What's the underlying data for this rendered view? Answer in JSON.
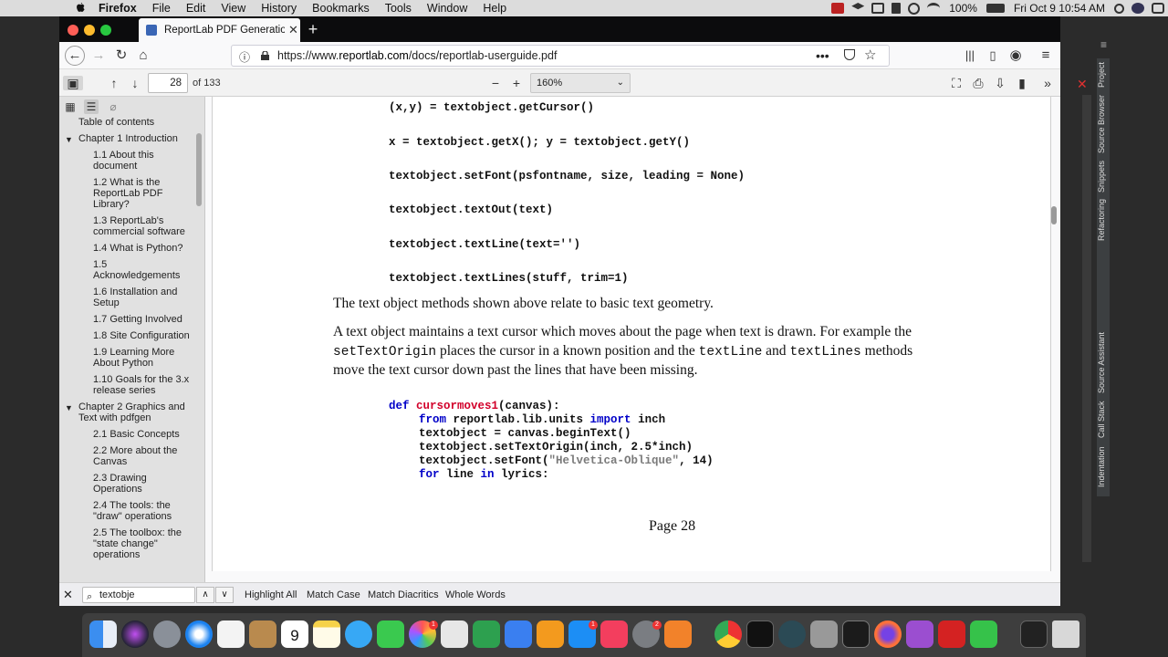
{
  "menubar": {
    "app_name": "Firefox",
    "items": [
      "File",
      "Edit",
      "View",
      "History",
      "Bookmarks",
      "Tools",
      "Window",
      "Help"
    ],
    "battery": "100%",
    "clock": "Fri Oct 9  10:54 AM"
  },
  "browser": {
    "tab_title": "ReportLab PDF Generation User Guide",
    "url_prefix": "https://www.",
    "url_domain": "reportlab.com",
    "url_path": "/docs/reportlab-userguide.pdf"
  },
  "pdf_toolbar": {
    "page_number": "28",
    "page_count": "of 133",
    "zoom": "160%"
  },
  "outline": [
    {
      "label": "Table of contents",
      "level": 0,
      "twisty": ""
    },
    {
      "label": "Chapter 1 Introduction",
      "level": 0,
      "twisty": "▼"
    },
    {
      "label": "1.1 About this document",
      "level": 1,
      "twisty": ""
    },
    {
      "label": "1.2 What is the ReportLab PDF Library?",
      "level": 1,
      "twisty": ""
    },
    {
      "label": "1.3 ReportLab's commercial software",
      "level": 1,
      "twisty": ""
    },
    {
      "label": "1.4 What is Python?",
      "level": 1,
      "twisty": ""
    },
    {
      "label": "1.5 Acknowledgements",
      "level": 1,
      "twisty": ""
    },
    {
      "label": "1.6 Installation and Setup",
      "level": 1,
      "twisty": ""
    },
    {
      "label": "1.7 Getting Involved",
      "level": 1,
      "twisty": ""
    },
    {
      "label": "1.8 Site Configuration",
      "level": 1,
      "twisty": ""
    },
    {
      "label": "1.9 Learning More About Python",
      "level": 1,
      "twisty": ""
    },
    {
      "label": "1.10 Goals for the 3.x release series",
      "level": 1,
      "twisty": ""
    },
    {
      "label": "Chapter 2 Graphics and Text with pdfgen",
      "level": 0,
      "twisty": "▼"
    },
    {
      "label": "2.1 Basic Concepts",
      "level": 1,
      "twisty": ""
    },
    {
      "label": "2.2 More about the Canvas",
      "level": 1,
      "twisty": ""
    },
    {
      "label": "2.3 Drawing Operations",
      "level": 1,
      "twisty": ""
    },
    {
      "label": "2.4 The tools: the \"draw\" operations",
      "level": 1,
      "twisty": ""
    },
    {
      "label": "2.5 The toolbox: the \"state change\" operations",
      "level": 1,
      "twisty": ""
    }
  ],
  "document": {
    "code_lines": [
      "(x,y) = textobject.getCursor()",
      "x = textobject.getX(); y = textobject.getY()",
      "textobject.setFont(psfontname, size, leading = None)",
      "textobject.textOut(text)",
      "textobject.textLine(text='')",
      "textobject.textLines(stuff, trim=1)"
    ],
    "para1": "The text object methods shown above relate to basic text geometry.",
    "para2_a": "A text object maintains a text cursor which moves about the page when text is drawn. For example the",
    "para2_code1": "setTextOrigin",
    "para2_b": " places the cursor in a known position and the ",
    "para2_code2": "textLine",
    "para2_c": " and ",
    "para2_code3": "textLines",
    "para2_d": " methods",
    "para2_e": "move the text cursor down past the lines that have been missing.",
    "example": {
      "def_kw": "def",
      "func_name": "cursormoves1",
      "sig": "(canvas):",
      "from_kw": "from",
      "import_module": " reportlab.lib.units ",
      "import_kw": "import",
      "import_name": " inch",
      "line3": "textobject = canvas.beginText()",
      "line4": "textobject.setTextOrigin(inch, 2.5*inch)",
      "line5_a": "textobject.setFont(",
      "line5_str": "\"Helvetica-Oblique\"",
      "line5_b": ", 14)",
      "for_kw": "for",
      "for_var": " line ",
      "in_kw": "in",
      "for_rest": " lyrics:"
    },
    "page_label": "Page 28"
  },
  "findbar": {
    "query": "textobje",
    "options": [
      "Highlight All",
      "Match Case",
      "Match Diacritics",
      "Whole Words"
    ]
  },
  "ide_tabs": [
    "Project",
    "Source Browser",
    "Snippets",
    "Refactoring",
    "Source Assistant",
    "Call Stack",
    "Indentation"
  ],
  "dock": {
    "calendar_day": "9",
    "badges": [
      "1",
      "1",
      "2"
    ]
  }
}
